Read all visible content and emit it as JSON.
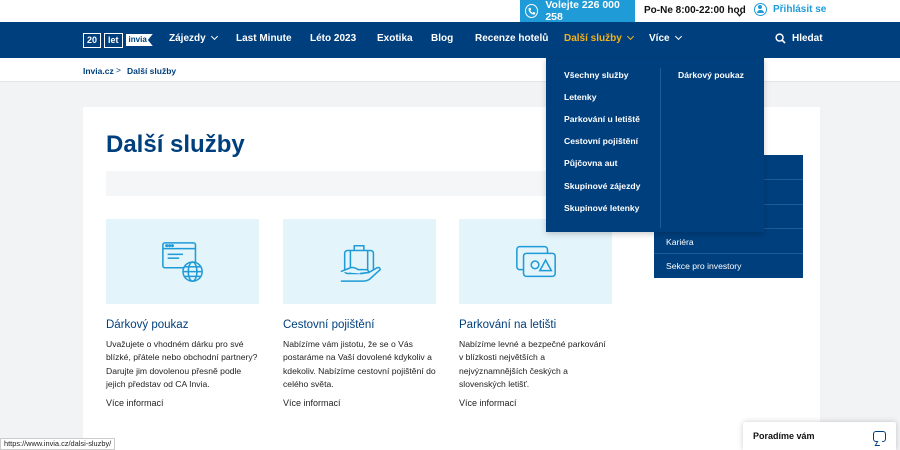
{
  "topbar": {
    "phone_label": "Volejte 226 000 258",
    "hours": "Po-Ne 8:00-22:00 hod",
    "login": "Přihlásit se"
  },
  "nav": {
    "logo": {
      "years": "20",
      "word": "let",
      "brand": "invia"
    },
    "items": [
      {
        "label": "Zájezdy",
        "dropdown": true
      },
      {
        "label": "Last Minute",
        "dropdown": false
      },
      {
        "label": "Léto 2023",
        "dropdown": false
      },
      {
        "label": "Exotika",
        "dropdown": false
      },
      {
        "label": "Blog",
        "dropdown": false
      },
      {
        "label": "Recenze hotelů",
        "dropdown": false
      },
      {
        "label": "Další služby",
        "dropdown": true,
        "active": true
      },
      {
        "label": "Více",
        "dropdown": true
      }
    ],
    "search": "Hledat"
  },
  "breadcrumb": {
    "home": "Invia.cz",
    "separator": ">",
    "current": "Další služby"
  },
  "page": {
    "title": "Další služby"
  },
  "services": [
    {
      "icon": "web-globe-icon",
      "title": "Dárkový poukaz",
      "description": "Uvažujete o vhodném dárku pro své blízké, přátele nebo obchodní partnery? Darujte jim dovolenou přesně podle jejich představ od CA Invia.",
      "more": "Více informací"
    },
    {
      "icon": "suitcase-hand-icon",
      "title": "Cestovní pojištění",
      "description": "Nabízíme vám jistotu, že se o Vás postaráme na Vaší dovolené kdykoliv a kdekoliv. Nabízíme cestovní pojištění do celého světa.",
      "more": "Více informací"
    },
    {
      "icon": "parking-ticket-icon",
      "title": "Parkování na letišti",
      "description": "Nabízíme levné a bezpečné parkování v blízkosti největších a nejvýznamnějších českých a slovenských letišť.",
      "more": "Více informací"
    }
  ],
  "dropdown": {
    "left": [
      "Všechny služby",
      "Letenky",
      "Parkování u letiště",
      "Cestovní pojištění",
      "Půjčovna aut",
      "Skupinové zájezdy",
      "Skupinové letenky"
    ],
    "right": "Dárkový poukaz"
  },
  "more_menu": {
    "items": [
      "Kariéra",
      "Sekce pro investory"
    ]
  },
  "chat": {
    "label": "Poradíme vám"
  },
  "status_url": "https://www.invia.cz/dalsi-sluzby/",
  "colors": {
    "primary": "#003f7d",
    "accent": "#1f9bd7",
    "active": "#f5b21b",
    "tile_bg": "#e3f4fb"
  }
}
